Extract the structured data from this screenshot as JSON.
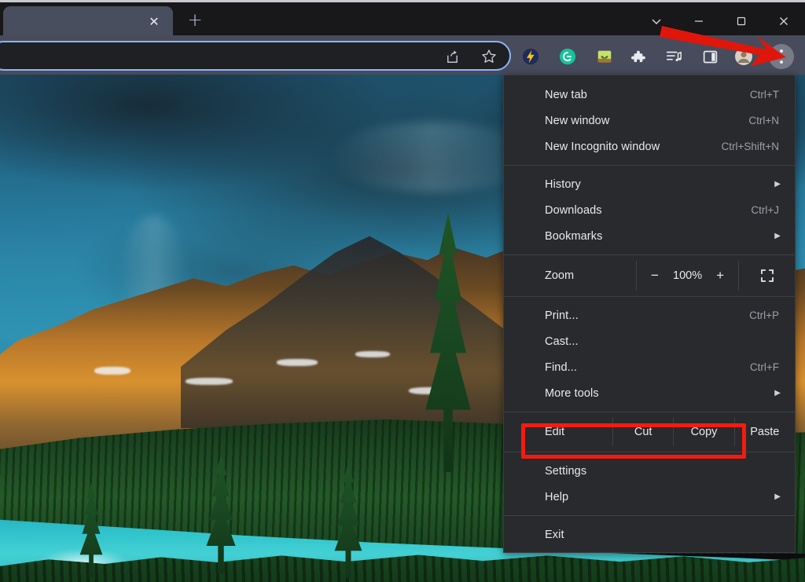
{
  "window": {
    "controls": [
      {
        "name": "tab-search",
        "icon": "chevron-down-icon",
        "label": "Search tabs"
      },
      {
        "name": "minimize",
        "icon": "minimize-icon",
        "label": "Minimize"
      },
      {
        "name": "maximize",
        "icon": "maximize-icon",
        "label": "Restore"
      },
      {
        "name": "close",
        "icon": "close-icon",
        "label": "Close"
      }
    ]
  },
  "tabstrip": {
    "active_tab": {
      "title": "",
      "close_glyph": "✕"
    },
    "new_tab_glyph": "+",
    "new_tab_label": "New tab"
  },
  "toolbar": {
    "omnibox": {
      "value": "",
      "placeholder": ""
    },
    "omnibox_icons": [
      {
        "name": "share-icon",
        "label": "Share this page"
      },
      {
        "name": "bookmark-star-icon",
        "label": "Bookmark this tab"
      }
    ],
    "extensions": [
      {
        "name": "lightning-extension-icon",
        "label": "Lightning"
      },
      {
        "name": "grammarly-icon",
        "label": "Grammarly",
        "glyph": "G",
        "color": "#15c39a"
      },
      {
        "name": "plant-extension-icon",
        "label": "Plant"
      },
      {
        "name": "puzzle-extensions-icon",
        "label": "Extensions"
      },
      {
        "name": "media-playlist-icon",
        "label": "Media"
      },
      {
        "name": "side-panel-icon",
        "label": "Side panel"
      },
      {
        "name": "profile-avatar-icon",
        "label": "Profile"
      }
    ],
    "menu_button": {
      "name": "chrome-menu-button",
      "label": "Customize and control Google Chrome"
    }
  },
  "menu": {
    "groups": [
      {
        "items": [
          {
            "label": "New tab",
            "accel": "Ctrl+T",
            "submenu": false
          },
          {
            "label": "New window",
            "accel": "Ctrl+N",
            "submenu": false
          },
          {
            "label": "New Incognito window",
            "accel": "Ctrl+Shift+N",
            "submenu": false
          }
        ]
      },
      {
        "items": [
          {
            "label": "History",
            "accel": "",
            "submenu": true
          },
          {
            "label": "Downloads",
            "accel": "Ctrl+J",
            "submenu": false
          },
          {
            "label": "Bookmarks",
            "accel": "",
            "submenu": true
          }
        ]
      }
    ],
    "zoom": {
      "label": "Zoom",
      "minus": "−",
      "value": "100%",
      "plus": "+",
      "fullscreen_label": "Full screen"
    },
    "middle_items": [
      {
        "label": "Print...",
        "accel": "Ctrl+P",
        "submenu": false
      },
      {
        "label": "Cast...",
        "accel": "",
        "submenu": false
      },
      {
        "label": "Find...",
        "accel": "Ctrl+F",
        "submenu": false
      },
      {
        "label": "More tools",
        "accel": "",
        "submenu": true
      }
    ],
    "edit_row": {
      "label": "Edit",
      "actions": [
        "Cut",
        "Copy",
        "Paste"
      ]
    },
    "lower_items": [
      {
        "label": "Settings",
        "accel": "",
        "submenu": false
      },
      {
        "label": "Help",
        "accel": "",
        "submenu": true
      }
    ],
    "exit_item": {
      "label": "Exit",
      "accel": "",
      "submenu": false
    },
    "arrow_glyph": "▶"
  },
  "annotations": {
    "highlight_color": "#f51b0e",
    "highlight_target": "Settings",
    "arrow_color": "#e0160b",
    "arrow_target": "chrome-menu-button"
  },
  "page": {
    "image_description": "Mountain lake landscape with turquoise water, evergreen forest and sunlit golden peaks under a blue sky"
  }
}
